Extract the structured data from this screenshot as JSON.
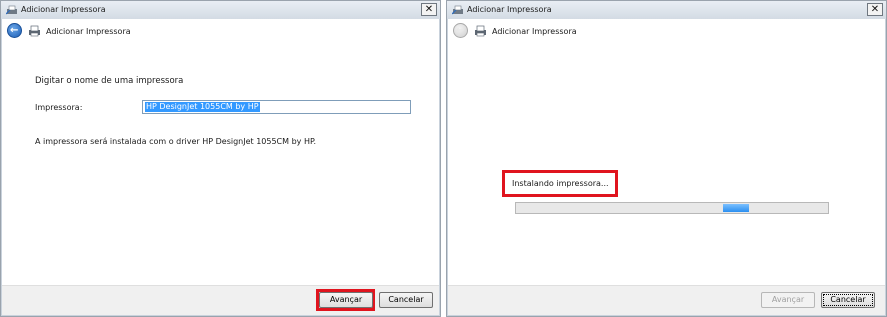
{
  "left": {
    "title": "Adicionar Impressora",
    "close": "✕",
    "wizard_title": "Adicionar Impressora",
    "heading": "Digitar o nome de uma impressora",
    "printer_label": "Impressora:",
    "printer_value": "HP DesignJet 1055CM by HP",
    "driver_note": "A impressora será instalada com o driver HP DesignJet 1055CM by HP.",
    "next_label": "Avançar",
    "cancel_label": "Cancelar"
  },
  "right": {
    "title": "Adicionar Impressora",
    "close": "✕",
    "wizard_title": "Adicionar Impressora",
    "status": "Instalando impressora...",
    "progress_position": 0.73,
    "next_label": "Avançar",
    "cancel_label": "Cancelar"
  },
  "colors": {
    "highlight": "#e0141e",
    "progress": "#2a8ff0",
    "selection": "#3399ff"
  },
  "icons": {
    "title_icon": "printer-wizard-icon",
    "back": "back-arrow-icon",
    "header_icon": "printer-icon"
  }
}
